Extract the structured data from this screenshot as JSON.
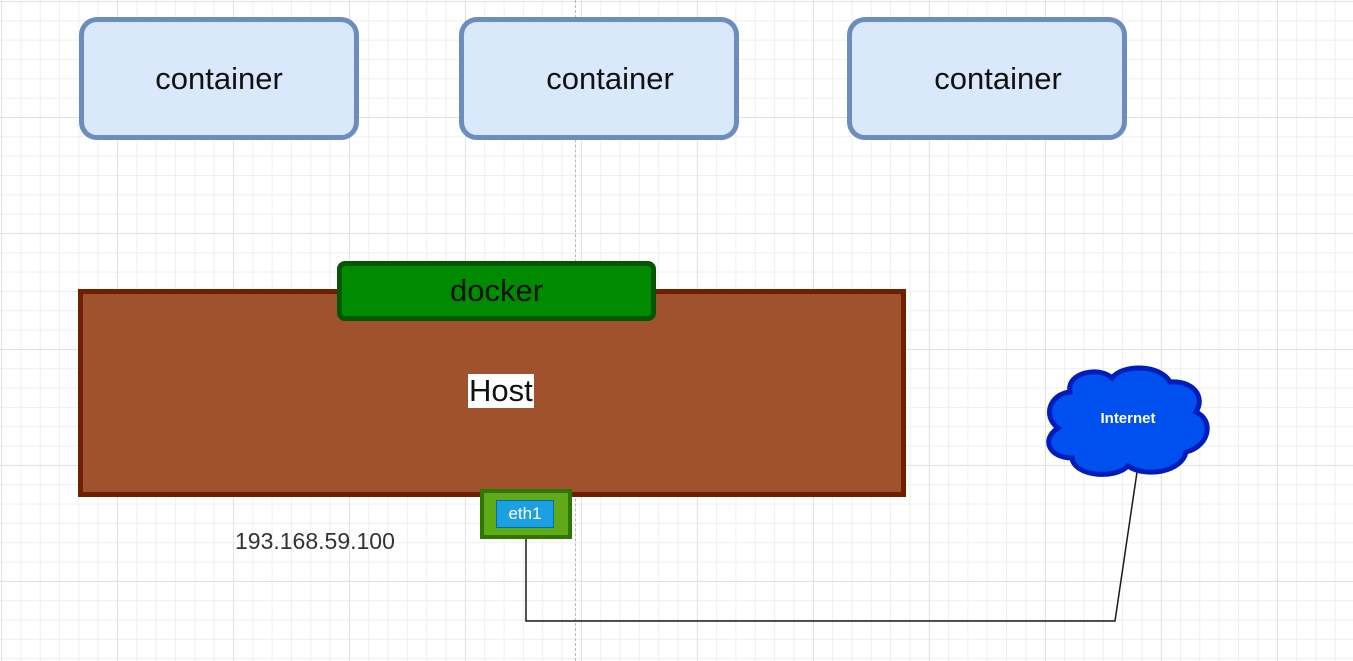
{
  "containers": [
    {
      "label": "container"
    },
    {
      "label": "container"
    },
    {
      "label": "container"
    }
  ],
  "host": {
    "label": "Host",
    "fill": "#a0522d",
    "stroke": "#6d1f00"
  },
  "docker": {
    "label": "docker",
    "fill": "#008a00",
    "stroke": "#005700"
  },
  "interface": {
    "label": "eth1",
    "fill": "#1ba1e2"
  },
  "host_ip": "193.168.59.100",
  "internet": {
    "label": "Internet",
    "icon": "cloud-icon",
    "fill": "#0050ef",
    "stroke": "#001dbc"
  },
  "colors": {
    "container_fill": "#dae8fc",
    "container_stroke": "#6c8ebf"
  }
}
